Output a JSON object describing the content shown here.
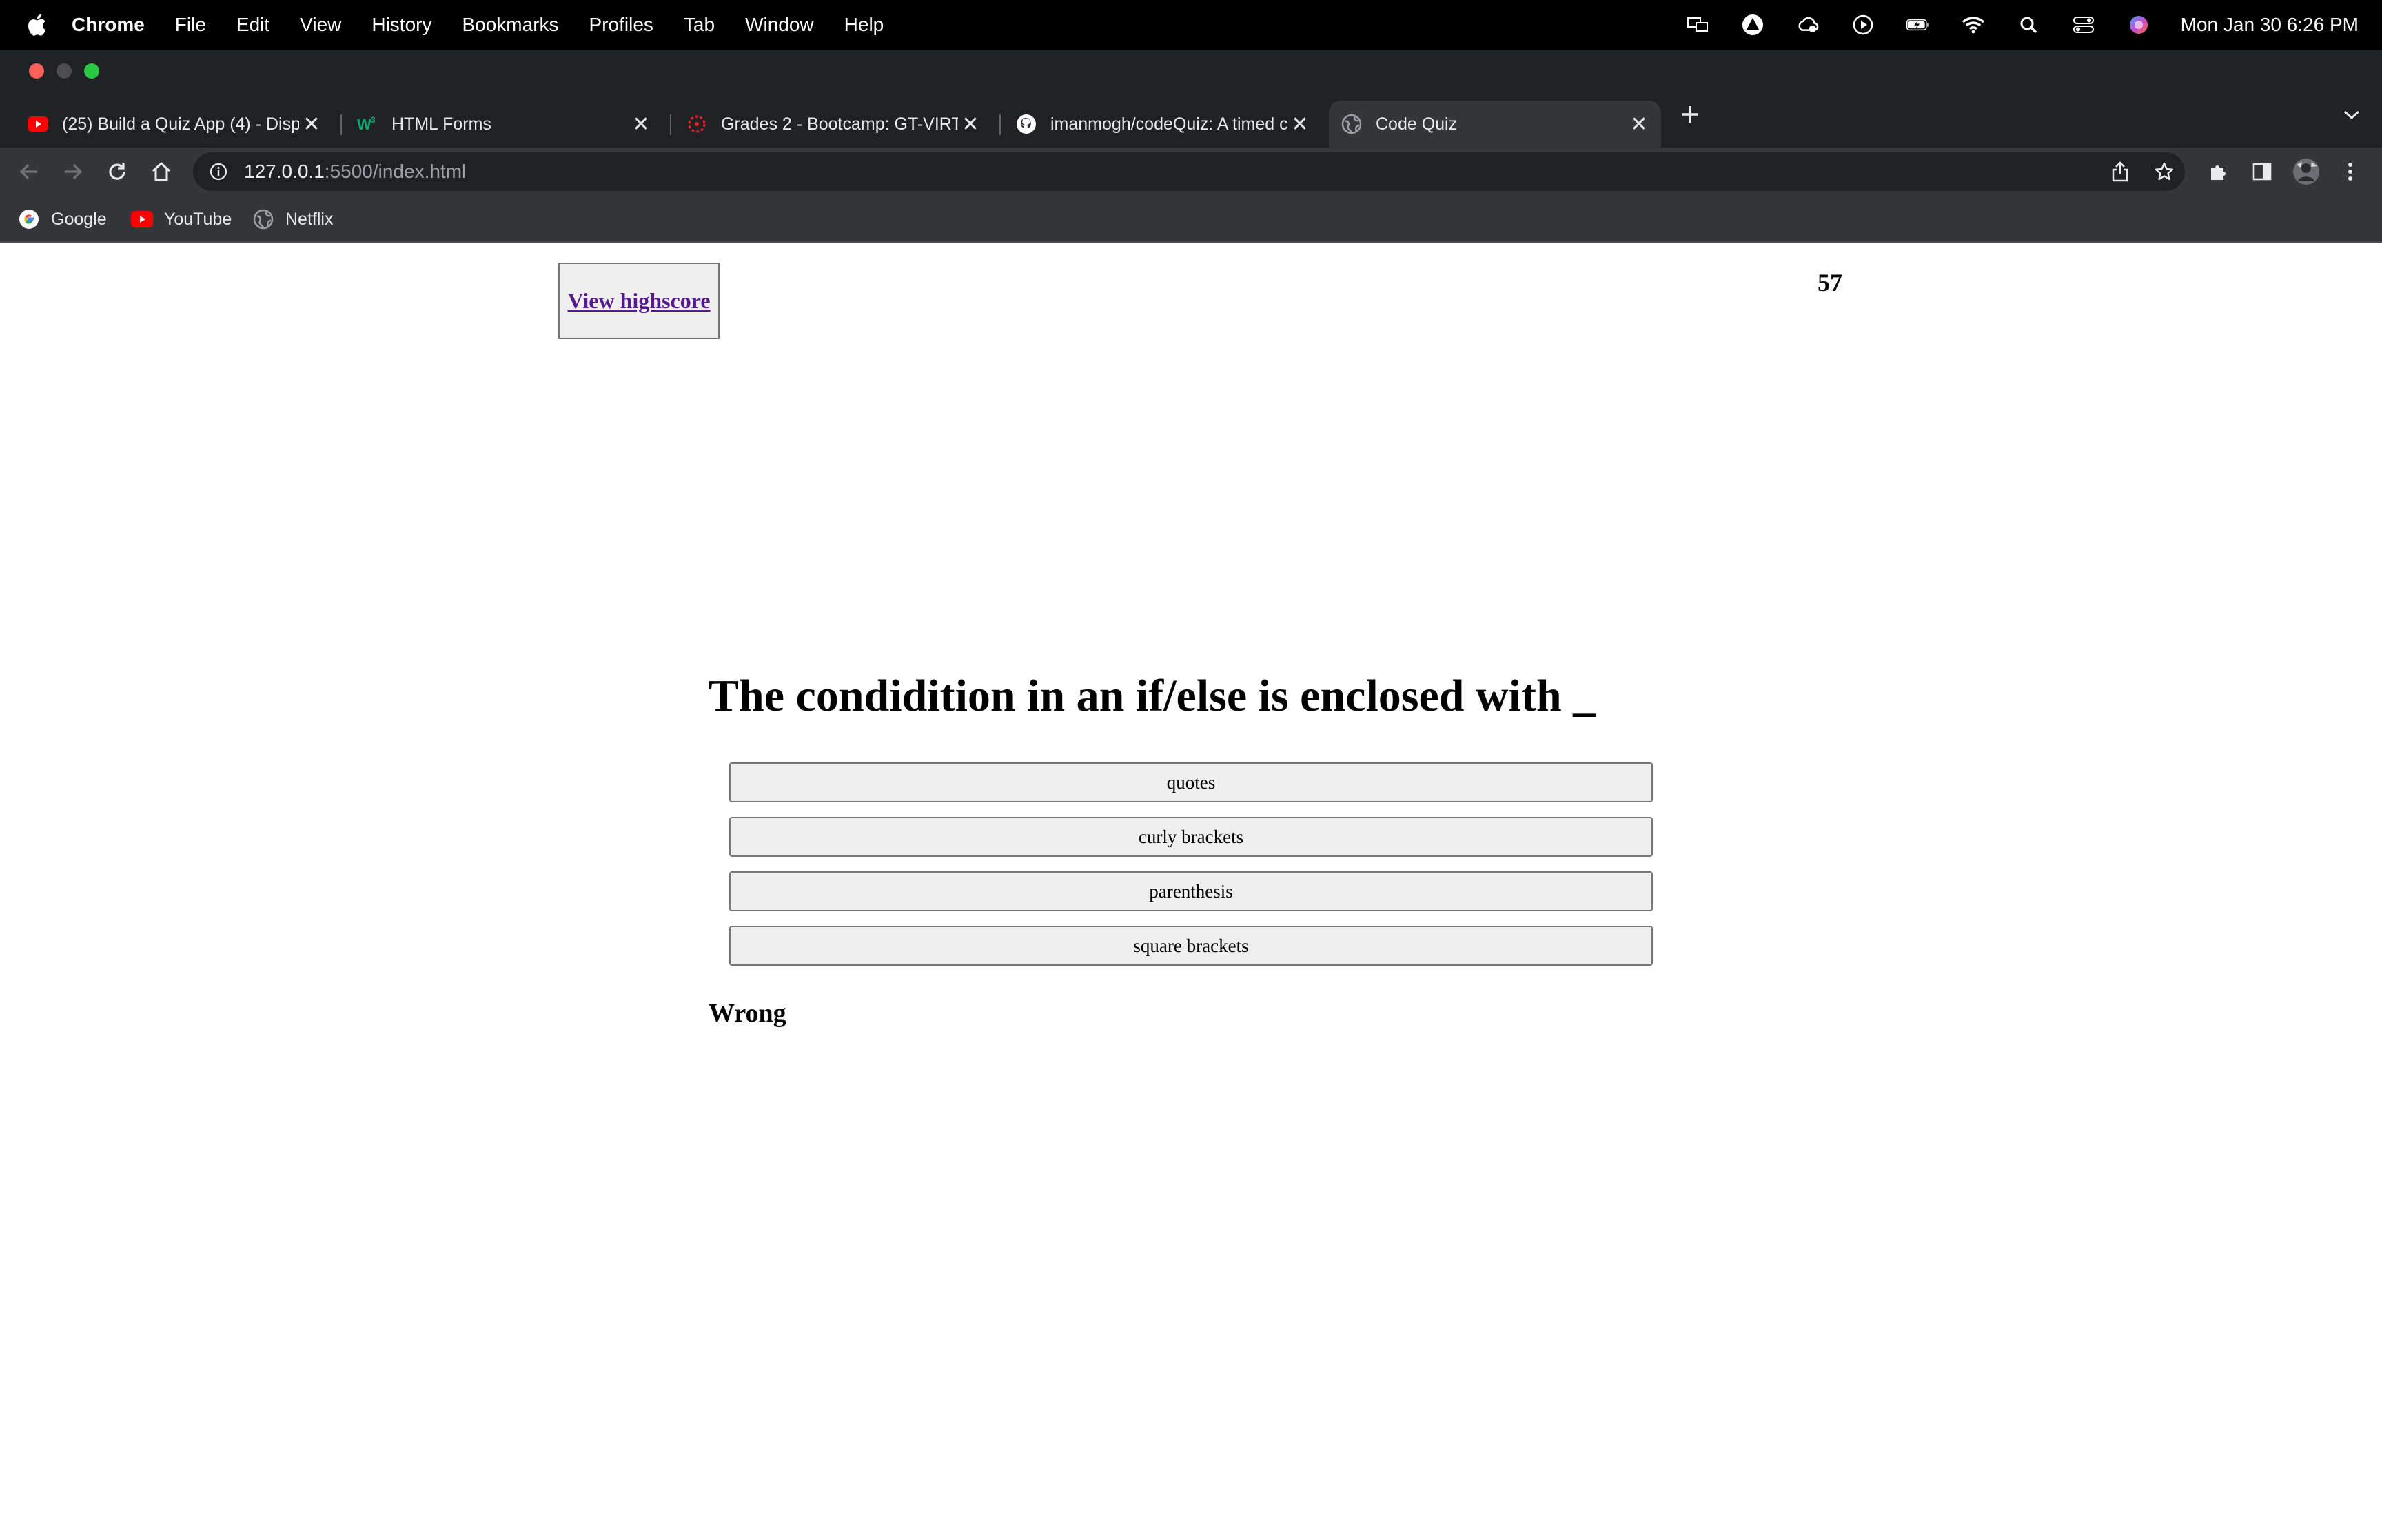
{
  "menubar": {
    "app": "Chrome",
    "items": [
      "File",
      "Edit",
      "View",
      "History",
      "Bookmarks",
      "Profiles",
      "Tab",
      "Window",
      "Help"
    ],
    "clock": "Mon Jan 30  6:26 PM",
    "status_icons": [
      "display-icon",
      "vpn-icon",
      "cloud-icon",
      "play-icon",
      "battery-icon",
      "wifi-icon",
      "spotlight-search-icon",
      "control-center-icon",
      "siri-icon"
    ]
  },
  "tabs": [
    {
      "title": "(25) Build a Quiz App (4) - Disp",
      "icon": "youtube-icon"
    },
    {
      "title": "HTML Forms",
      "icon": "w3schools-icon"
    },
    {
      "title": "Grades 2 - Bootcamp: GT-VIRT",
      "icon": "canvas-icon"
    },
    {
      "title": "imanmogh/codeQuiz: A timed c",
      "icon": "github-icon"
    },
    {
      "title": "Code Quiz",
      "icon": "globe-icon",
      "active": true
    }
  ],
  "address_bar": {
    "host": "127.0.0.1",
    "path": ":5500/index.html"
  },
  "bookmarks": [
    {
      "label": "Google",
      "icon": "google-icon"
    },
    {
      "label": "YouTube",
      "icon": "youtube-icon"
    },
    {
      "label": "Netflix",
      "icon": "globe-icon"
    }
  ],
  "quiz": {
    "highscore_link": "View highscore",
    "timer": "57",
    "question": "The condidition in an if/else is enclosed with _",
    "answers": [
      "quotes",
      "curly brackets",
      "parenthesis",
      "square brackets"
    ],
    "feedback": "Wrong"
  },
  "colors": {
    "menubar": "#000000",
    "chrome_frame": "#202124",
    "chrome_toolbar": "#35363a",
    "link": "#551a8b",
    "button_bg": "#efefef"
  }
}
